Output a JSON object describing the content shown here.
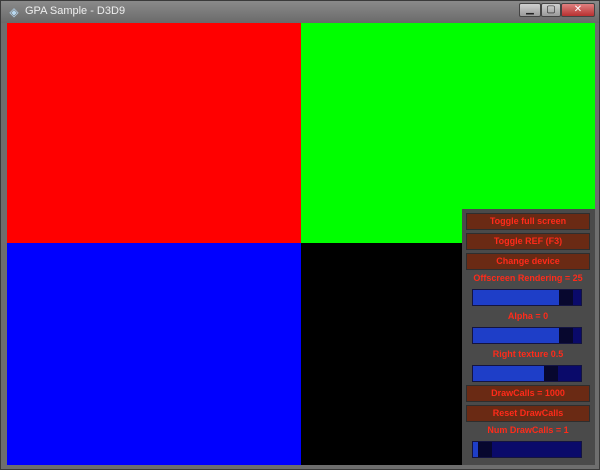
{
  "window": {
    "title": "GPA Sample - D3D9",
    "icon": "app-icon",
    "controls": {
      "minimize": "▁",
      "maximize": "▢",
      "close": "✕"
    }
  },
  "canvas": {
    "quadrants": [
      {
        "name": "top-left",
        "color": "#ff0000"
      },
      {
        "name": "top-right",
        "color": "#00ff00"
      },
      {
        "name": "bottom-left",
        "color": "#0000ff"
      },
      {
        "name": "bottom-right",
        "color": "#000000"
      }
    ]
  },
  "panel": {
    "toggle_fullscreen": "Toggle full screen",
    "toggle_ref": "Toggle REF (F3)",
    "change_device": "Change device",
    "offscreen_label": "Offscreen Rendering = 25",
    "offscreen_slider_value": 0.92,
    "alpha_label": "Alpha = 0",
    "alpha_slider_value": 0.92,
    "right_label": "Right texture 0.5",
    "right_slider_value": 0.75,
    "drawcalls_label": "DrawCalls = 1000",
    "reset_drawcalls": "Reset DrawCalls",
    "drawcalls_count_label": "Num DrawCalls = 1",
    "drawcalls_slider_value": 0.05
  },
  "colors": {
    "panel_bg": "#4a4a4a",
    "button_bg": "#6a2a14",
    "label_text": "#ff2b1a",
    "slider_track": "#1e3ec8",
    "slider_handle": "#07072e"
  }
}
